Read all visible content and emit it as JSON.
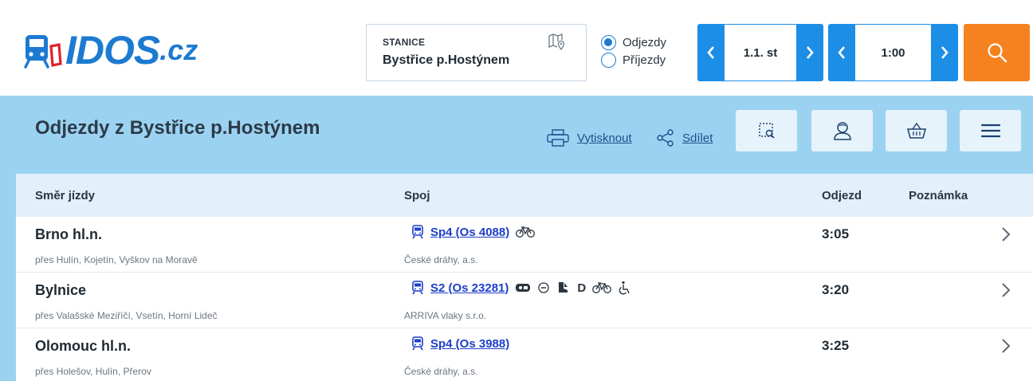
{
  "header": {
    "logo_text": "IDOS",
    "logo_tld": ".cz",
    "station": {
      "label": "STANICE",
      "value": "Bystřice p.Hostýnem"
    },
    "direction_options": [
      {
        "label": "Odjezdy",
        "checked": true
      },
      {
        "label": "Příjezdy",
        "checked": false
      }
    ],
    "date": "1.1. st",
    "time": "1:00",
    "accent_color": "#1c8ee6",
    "search_color": "#f5821f"
  },
  "toolbar": {
    "title": "Odjezdy z Bystřice p.Hostýnem",
    "print_label": "Vytisknout",
    "share_label": "Sdílet",
    "buttons": [
      "timetable-search-icon",
      "user-icon",
      "basket-icon",
      "menu-icon"
    ]
  },
  "table": {
    "columns": [
      "Směr jízdy",
      "Spoj",
      "Odjezd",
      "Poznámka"
    ],
    "rows": [
      {
        "destination": "Brno hl.n.",
        "via": "přes Hulín, Kojetín, Vyškov na Moravě",
        "connection": "Sp4 (Os 4088)",
        "carrier": "České dráhy, a.s.",
        "departure": "3:05",
        "features": [
          "bicycle-icon"
        ]
      },
      {
        "destination": "Bylnice",
        "via": "přes Valašské Meziříčí, Vsetín, Horní Lideč",
        "connection": "S2 (Os 23281)",
        "carrier": "ARRIVA vlaky s.r.o.",
        "departure": "3:20",
        "features": [
          "ticket-icon",
          "circle-icon",
          "pram-icon",
          "D",
          "bicycle-icon",
          "wheelchair-icon"
        ]
      },
      {
        "destination": "Olomouc hl.n.",
        "via": "přes Holešov, Hulín, Přerov",
        "connection": "Sp4 (Os 3988)",
        "carrier": "České dráhy, a.s.",
        "departure": "3:25",
        "features": []
      }
    ]
  }
}
